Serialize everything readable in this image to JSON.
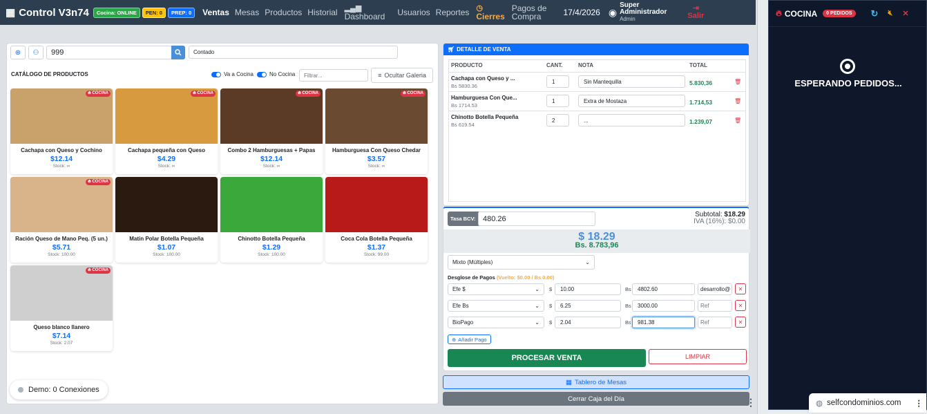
{
  "nav": {
    "brand": "Control V3n74",
    "badge_cocina": "Cocina: ONLINE",
    "badge_pen": "PEN: 0",
    "badge_prep": "PREP: 0",
    "links": [
      "Ventas",
      "Mesas",
      "Productos",
      "Historial"
    ],
    "dashboard": "Dashboard",
    "usuarios": "Usuarios",
    "reportes": "Reportes",
    "cierres": "Cierres",
    "pagos": "Pagos de",
    "compra": "Compra",
    "date": "17/4/2026",
    "user_line1": "Super",
    "user_line2": "Administrador",
    "role": "Admin",
    "salir": "Salir"
  },
  "search": {
    "client_value": "999",
    "name_value": "Contado"
  },
  "catalog": {
    "title": "CATÁLOGO DE PRODUCTOS",
    "toggle1": "Va a Cocina",
    "toggle2": "No Cocina",
    "filter_placeholder": "Filtrar...",
    "hide_gallery": "Ocultar Galeria",
    "kitchen_badge": "COCINA",
    "products": [
      {
        "name": "Cachapa con Queso y Cochino",
        "price": "$12.14",
        "stock": "Stock: ∞",
        "kitchen": true
      },
      {
        "name": "Cachapa pequeña con Queso",
        "price": "$4.29",
        "stock": "Stock: ∞",
        "kitchen": true
      },
      {
        "name": "Combo 2 Hamburguesas + Papas",
        "price": "$12.14",
        "stock": "Stock: ∞",
        "kitchen": true
      },
      {
        "name": "Hamburguesa Con Queso Chedar",
        "price": "$3.57",
        "stock": "Stock: ∞",
        "kitchen": true
      },
      {
        "name": "Ración Queso de Mano Peq. (5 un.)",
        "price": "$5.71",
        "stock": "Stock: 100.00",
        "kitchen": true
      },
      {
        "name": "Matin Polar Botella Pequeña",
        "price": "$1.07",
        "stock": "Stock: 100.00",
        "kitchen": false
      },
      {
        "name": "Chinotto Botella Pequeña",
        "price": "$1.29",
        "stock": "Stock: 100.00",
        "kitchen": false
      },
      {
        "name": "Coca Cola Botella Pequeña",
        "price": "$1.37",
        "stock": "Stock: 99.00",
        "kitchen": false
      },
      {
        "name": "Queso blanco llanero",
        "price": "$7.14",
        "stock": "Stock: 2.07",
        "kitchen": true
      }
    ]
  },
  "demo": "Demo: 0 Conexiones",
  "detail": {
    "title": "DETALLE DE VENTA",
    "headers": [
      "PRODUCTO",
      "CANT.",
      "NOTA",
      "TOTAL"
    ],
    "rows": [
      {
        "name": "Cachapa con Queso y ...",
        "bs": "Bs 5830.36",
        "qty": "1",
        "note": "Sin Mantequilla",
        "total": "5.830,36"
      },
      {
        "name": "Hamburguesa Con Que...",
        "bs": "Bs 1714.53",
        "qty": "1",
        "note": "Extra de Mostaza",
        "total": "1.714,53"
      },
      {
        "name": "Chinotto Botella Pequeña",
        "bs": "Bs 619.54",
        "qty": "2",
        "note": "...",
        "total": "1.239,07"
      }
    ]
  },
  "payment": {
    "tasa_label": "Tasa BCV:",
    "tasa_value": "480.26",
    "subtotal_label": "Subtotal:",
    "subtotal": "$18.29",
    "iva_label": "IVA (16%):",
    "iva": "$0.00",
    "total_usd": "$ 18.29",
    "total_bs": "Bs. 8.783,96",
    "method": "Mixto (Múltiples)",
    "desglose": "Desglose de Pagos",
    "vuelto": "(Vuelto: $0.00 / Bs 0.00)",
    "lines": [
      {
        "method": "Efe $",
        "usd": "10.00",
        "bs": "4802.60",
        "ref": "desarrollo@"
      },
      {
        "method": "Efe Bs",
        "usd": "6.25",
        "bs": "3000.00",
        "ref": "Ref"
      },
      {
        "method": "BioPago",
        "usd": "2.04",
        "bs": "981.38",
        "ref": "Ref"
      }
    ],
    "add": "Añadir Pago",
    "process": "PROCESAR VENTA",
    "clear": "LIMPIAR",
    "mesas": "Tablero de Mesas",
    "cerrar": "Cerrar Caja del Día"
  },
  "kitchen": {
    "title": "COCINA",
    "badge": "0 PEDIDOS",
    "waiting": "ESPERANDO PEDIDOS..."
  },
  "domain": "selfcondominios.com"
}
